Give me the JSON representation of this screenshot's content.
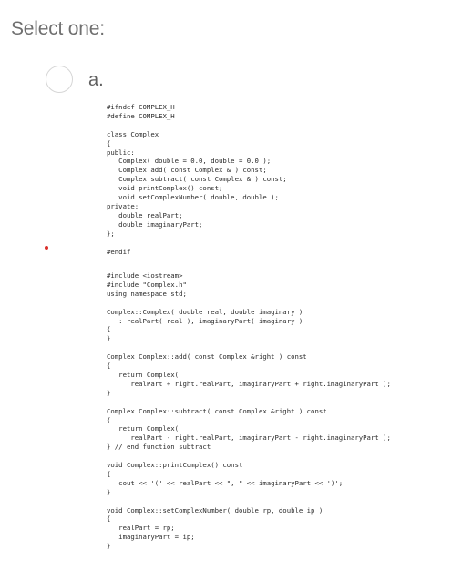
{
  "question": {
    "prompt": "Select one:"
  },
  "option_a": {
    "letter": "a.",
    "selected": false,
    "code_header": "#ifndef COMPLEX_H\n#define COMPLEX_H\n\nclass Complex\n{\npublic:\n   Complex( double = 0.0, double = 0.0 );\n   Complex add( const Complex & ) const;\n   Complex subtract( const Complex & ) const;\n   void printComplex() const;\n   void setComplexNumber( double, double );\nprivate:\n   double realPart;\n   double imaginaryPart;\n};\n\n#endif",
    "code_impl": "#include <iostream>\n#include \"Complex.h\"\nusing namespace std;\n\nComplex::Complex( double real, double imaginary )\n   : realPart( real ), imaginaryPart( imaginary )\n{\n}\n\nComplex Complex::add( const Complex &right ) const\n{\n   return Complex(\n      realPart + right.realPart, imaginaryPart + right.imaginaryPart );\n}\n\nComplex Complex::subtract( const Complex &right ) const\n{\n   return Complex(\n      realPart - right.realPart, imaginaryPart - right.imaginaryPart );\n} // end function subtract\n\nvoid Complex::printComplex() const\n{\n   cout << '(' << realPart << \", \" << imaginaryPart << ')';\n}\n\nvoid Complex::setComplexNumber( double rp, double ip )\n{\n   realPart = rp;\n   imaginaryPart = ip;\n}"
  },
  "colors": {
    "prompt_text": "#6f6f6f",
    "radio_border": "#d6d6d6",
    "bullet": "#d9302c",
    "code_text": "#2a2a2a"
  },
  "icons": {
    "bullet": "red-dot-icon"
  }
}
